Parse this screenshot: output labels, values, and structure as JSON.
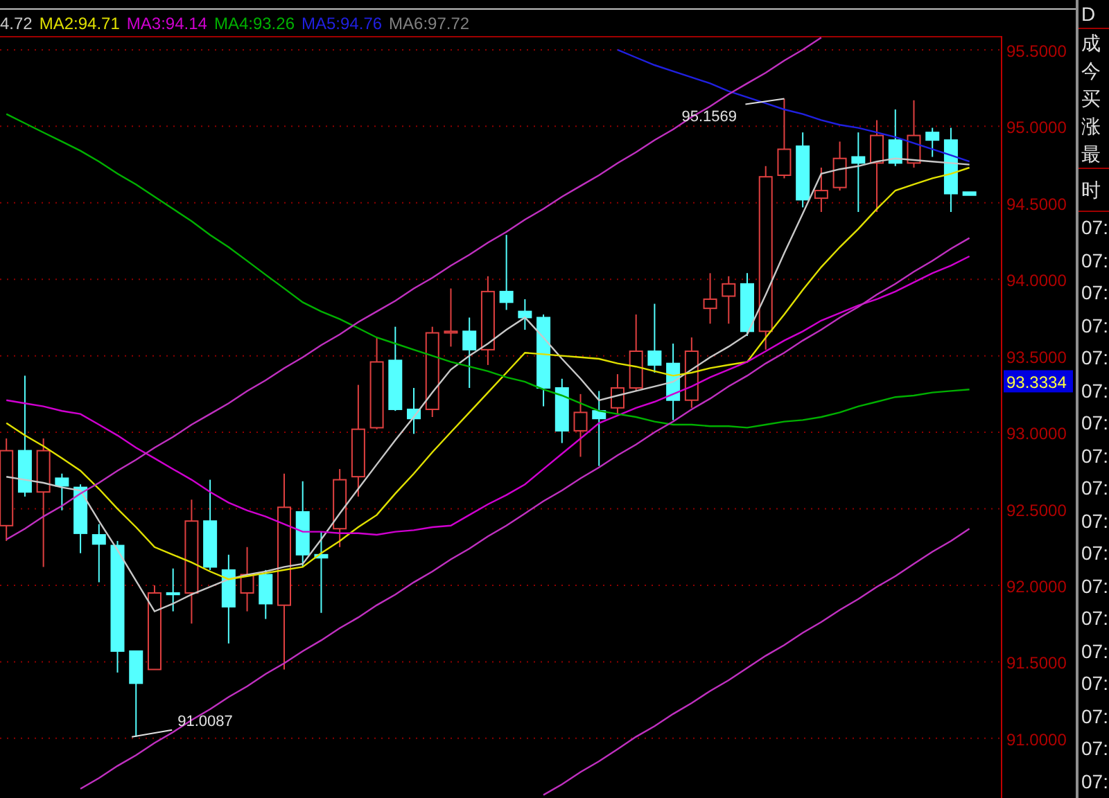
{
  "legend": {
    "values": [
      "4.72",
      ":94.71",
      ":94.14",
      ":93.26",
      ":94.76"
    ],
    "extra": {
      "name": "MA6",
      "value": ":97.72",
      "color": "#808080"
    }
  },
  "chart": {
    "chart_data": {
      "type": "candlestick",
      "grid": true,
      "ylim": [
        90.61,
        95.59
      ],
      "yticks": [
        {
          "value": 95.5,
          "label": "95.5000"
        },
        {
          "value": 95,
          "label": "95.0000"
        },
        {
          "value": 94.5,
          "label": "94.5000"
        },
        {
          "value": 94,
          "label": "94.0000"
        },
        {
          "value": 93.5,
          "label": "93.5000"
        },
        {
          "value": 93,
          "label": "93.0000"
        },
        {
          "value": 92.5,
          "label": "92.5000"
        },
        {
          "value": 92,
          "label": "92.0000"
        },
        {
          "value": 91.5,
          "label": "91.5000"
        },
        {
          "value": 91,
          "label": "91.0000"
        }
      ],
      "ohlc": [
        [
          92.39,
          92.96,
          92.29,
          92.88
        ],
        [
          92.88,
          93.37,
          92.58,
          92.61
        ],
        [
          92.61,
          92.96,
          92.12,
          92.88
        ],
        [
          92.7,
          92.73,
          92.49,
          92.65
        ],
        [
          92.64,
          92.66,
          92.21,
          92.34
        ],
        [
          92.33,
          92.4,
          92.02,
          92.27
        ],
        [
          92.26,
          92.29,
          91.43,
          91.57
        ],
        [
          91.57,
          91.57,
          91.01,
          91.36
        ],
        [
          91.45,
          92.0,
          91.45,
          91.95
        ],
        [
          91.95,
          92.11,
          91.83,
          91.94
        ],
        [
          91.95,
          92.56,
          91.75,
          92.42
        ],
        [
          92.42,
          92.69,
          92.1,
          92.12
        ],
        [
          92.1,
          92.2,
          91.62,
          91.86
        ],
        [
          91.95,
          92.25,
          91.83,
          92.07
        ],
        [
          92.07,
          92.1,
          91.78,
          91.88
        ],
        [
          91.87,
          92.73,
          91.45,
          92.51
        ],
        [
          92.48,
          92.68,
          92.12,
          92.2
        ],
        [
          92.2,
          92.35,
          91.82,
          92.18
        ],
        [
          92.37,
          92.76,
          92.25,
          92.69
        ],
        [
          92.71,
          93.31,
          92.58,
          93.02
        ],
        [
          93.03,
          93.62,
          93.02,
          93.46
        ],
        [
          93.47,
          93.69,
          93.14,
          93.15
        ],
        [
          93.15,
          93.29,
          92.99,
          93.09
        ],
        [
          93.15,
          93.69,
          93.1,
          93.65
        ],
        [
          93.65,
          93.94,
          93.56,
          93.66
        ],
        [
          93.66,
          93.75,
          93.29,
          93.54
        ],
        [
          93.54,
          94.02,
          93.44,
          93.92
        ],
        [
          93.92,
          94.29,
          93.8,
          93.85
        ],
        [
          93.79,
          93.87,
          93.67,
          93.75
        ],
        [
          93.75,
          93.77,
          93.17,
          93.29
        ],
        [
          93.29,
          93.35,
          92.93,
          93.01
        ],
        [
          93.01,
          93.25,
          92.84,
          93.13
        ],
        [
          93.14,
          93.27,
          92.78,
          93.09
        ],
        [
          93.16,
          93.38,
          93.12,
          93.29
        ],
        [
          93.29,
          93.77,
          93.27,
          93.53
        ],
        [
          93.53,
          93.84,
          93.39,
          93.44
        ],
        [
          93.45,
          93.58,
          93.08,
          93.21
        ],
        [
          93.21,
          93.62,
          93.16,
          93.53
        ],
        [
          93.81,
          94.04,
          93.71,
          93.87
        ],
        [
          93.89,
          94.02,
          93.71,
          93.97
        ],
        [
          93.97,
          94.04,
          93.63,
          93.66
        ],
        [
          93.66,
          94.74,
          93.54,
          94.67
        ],
        [
          94.68,
          95.18,
          94.66,
          94.85
        ],
        [
          94.87,
          94.96,
          94.47,
          94.52
        ],
        [
          94.53,
          94.73,
          94.44,
          94.58
        ],
        [
          94.6,
          94.9,
          94.58,
          94.79
        ],
        [
          94.8,
          94.96,
          94.44,
          94.76
        ],
        [
          94.76,
          95.04,
          94.44,
          94.94
        ],
        [
          94.91,
          95.11,
          94.74,
          94.76
        ],
        [
          94.76,
          95.17,
          94.73,
          94.94
        ],
        [
          94.96,
          94.99,
          94.8,
          94.91
        ],
        [
          94.91,
          94.99,
          94.44,
          94.56
        ],
        [
          94.57,
          94.57,
          94.55,
          94.55
        ]
      ],
      "series": [
        {
          "type": "line",
          "color": "#c8c8c8",
          "values": [
            92.71,
            92.69,
            92.67,
            92.64,
            92.62,
            92.42,
            92.23,
            92.03,
            91.83,
            91.88,
            91.94,
            91.99,
            92.04,
            92.07,
            92.09,
            92.12,
            92.14,
            92.3,
            92.47,
            92.63,
            92.79,
            92.95,
            93.1,
            93.26,
            93.41,
            93.5,
            93.58,
            93.67,
            93.75,
            93.62,
            93.48,
            93.35,
            93.21,
            93.24,
            93.27,
            93.3,
            93.33,
            93.41,
            93.49,
            93.56,
            93.64,
            93.9,
            94.17,
            94.43,
            94.69,
            94.72,
            94.74,
            94.77,
            94.79,
            94.78,
            94.77,
            94.76,
            94.75
          ]
        },
        {
          "type": "line",
          "name": "MA2",
          "color": "#e0e000",
          "values": [
            93.06,
            92.98,
            92.91,
            92.83,
            92.75,
            92.63,
            92.5,
            92.38,
            92.25,
            92.2,
            92.15,
            92.09,
            92.04,
            92.06,
            92.08,
            92.1,
            92.12,
            92.21,
            92.29,
            92.38,
            92.46,
            92.6,
            92.73,
            92.87,
            93.0,
            93.13,
            93.26,
            93.39,
            93.52,
            93.51,
            93.5,
            93.49,
            93.48,
            93.45,
            93.43,
            93.4,
            93.37,
            93.39,
            93.42,
            93.44,
            93.46,
            93.62,
            93.77,
            93.93,
            94.08,
            94.21,
            94.33,
            94.46,
            94.58,
            94.62,
            94.66,
            94.69,
            94.73
          ]
        },
        {
          "type": "line",
          "name": "MA3",
          "color": "#d000d0",
          "values": [
            93.21,
            93.19,
            93.17,
            93.14,
            93.12,
            93.05,
            92.98,
            92.9,
            92.83,
            92.76,
            92.69,
            92.61,
            92.54,
            92.49,
            92.45,
            92.4,
            92.35,
            92.35,
            92.34,
            92.34,
            92.33,
            92.35,
            92.36,
            92.38,
            92.39,
            92.46,
            92.53,
            92.59,
            92.66,
            92.76,
            92.86,
            92.96,
            93.06,
            93.11,
            93.16,
            93.2,
            93.25,
            93.3,
            93.36,
            93.41,
            93.46,
            93.53,
            93.6,
            93.66,
            93.73,
            93.78,
            93.83,
            93.87,
            93.92,
            93.98,
            94.04,
            94.09,
            94.15
          ]
        },
        {
          "type": "line",
          "name": "MA4",
          "color": "#00b000",
          "values": [
            95.08,
            95.02,
            94.96,
            94.9,
            94.84,
            94.77,
            94.69,
            94.62,
            94.54,
            94.46,
            94.38,
            94.29,
            94.21,
            94.12,
            94.03,
            93.94,
            93.85,
            93.79,
            93.74,
            93.68,
            93.62,
            93.58,
            93.54,
            93.5,
            93.46,
            93.43,
            93.4,
            93.36,
            93.33,
            93.28,
            93.24,
            93.19,
            93.14,
            93.12,
            93.1,
            93.07,
            93.05,
            93.05,
            93.04,
            93.04,
            93.03,
            93.05,
            93.07,
            93.08,
            93.1,
            93.13,
            93.17,
            93.2,
            93.23,
            93.24,
            93.26,
            93.27,
            93.28
          ]
        },
        {
          "type": "line",
          "name": "MA5",
          "color": "#2020e0",
          "values": [
            null,
            null,
            null,
            null,
            null,
            null,
            null,
            null,
            null,
            null,
            null,
            null,
            null,
            null,
            null,
            null,
            null,
            null,
            null,
            null,
            null,
            null,
            null,
            null,
            null,
            null,
            null,
            null,
            null,
            null,
            null,
            null,
            null,
            95.5,
            95.45,
            95.4,
            95.36,
            95.32,
            95.28,
            95.23,
            95.19,
            95.15,
            95.11,
            95.08,
            95.04,
            95.01,
            94.99,
            94.96,
            94.93,
            94.89,
            94.85,
            94.81,
            94.77
          ]
        },
        {
          "type": "line",
          "color": "#c030c0",
          "values": [
            92.3,
            92.37,
            92.45,
            92.52,
            92.6,
            92.67,
            92.75,
            92.82,
            92.9,
            92.97,
            93.05,
            93.12,
            93.19,
            93.27,
            93.34,
            93.42,
            93.49,
            93.57,
            93.64,
            93.72,
            93.79,
            93.86,
            93.94,
            94.01,
            94.09,
            94.16,
            94.24,
            94.31,
            94.39,
            94.46,
            94.54,
            94.61,
            94.68,
            94.76,
            94.83,
            94.91,
            94.98,
            95.06,
            95.13,
            95.21,
            95.28,
            95.35,
            95.43,
            95.5,
            95.58,
            null,
            null,
            null,
            null,
            null,
            null,
            null,
            null
          ]
        },
        {
          "type": "line",
          "color": "#c030c0",
          "values": [
            null,
            null,
            null,
            null,
            90.67,
            90.74,
            90.82,
            90.89,
            90.97,
            91.04,
            91.12,
            91.19,
            91.27,
            91.34,
            91.42,
            91.49,
            91.57,
            91.64,
            91.72,
            91.79,
            91.87,
            91.94,
            92.02,
            92.09,
            92.17,
            92.24,
            92.32,
            92.39,
            92.47,
            92.55,
            92.62,
            92.7,
            92.77,
            92.85,
            92.92,
            93.0,
            93.07,
            93.15,
            93.22,
            93.3,
            93.37,
            93.45,
            93.52,
            93.6,
            93.67,
            93.75,
            93.82,
            93.9,
            93.97,
            94.05,
            94.12,
            94.2,
            94.27
          ]
        },
        {
          "type": "line",
          "color": "#c030c0",
          "values": [
            null,
            null,
            null,
            null,
            null,
            null,
            null,
            null,
            null,
            null,
            null,
            null,
            null,
            null,
            null,
            null,
            null,
            null,
            null,
            null,
            null,
            null,
            null,
            null,
            null,
            null,
            null,
            null,
            null,
            90.63,
            90.7,
            90.78,
            90.85,
            90.93,
            91.01,
            91.08,
            91.16,
            91.23,
            91.31,
            91.38,
            91.46,
            91.54,
            91.61,
            91.69,
            91.76,
            91.84,
            91.91,
            91.99,
            92.06,
            92.14,
            92.22,
            92.29,
            92.37
          ]
        }
      ],
      "annotations": [
        {
          "text": "95.1569"
        },
        {
          "text": "91.0087"
        }
      ]
    },
    "price_tag": {
      "label": "93.3334"
    }
  },
  "side_panel": {
    "header": "D",
    "fields": [
      "成",
      "今",
      "买",
      "涨",
      "最"
    ],
    "time_header": "时",
    "times": [
      "07:",
      "07:",
      "07:",
      "07:",
      "07:",
      "07:",
      "07:",
      "07:",
      "07:",
      "07:",
      "07:",
      "07:",
      "07:",
      "07:",
      "07:",
      "07:",
      "07:",
      "07:"
    ]
  }
}
